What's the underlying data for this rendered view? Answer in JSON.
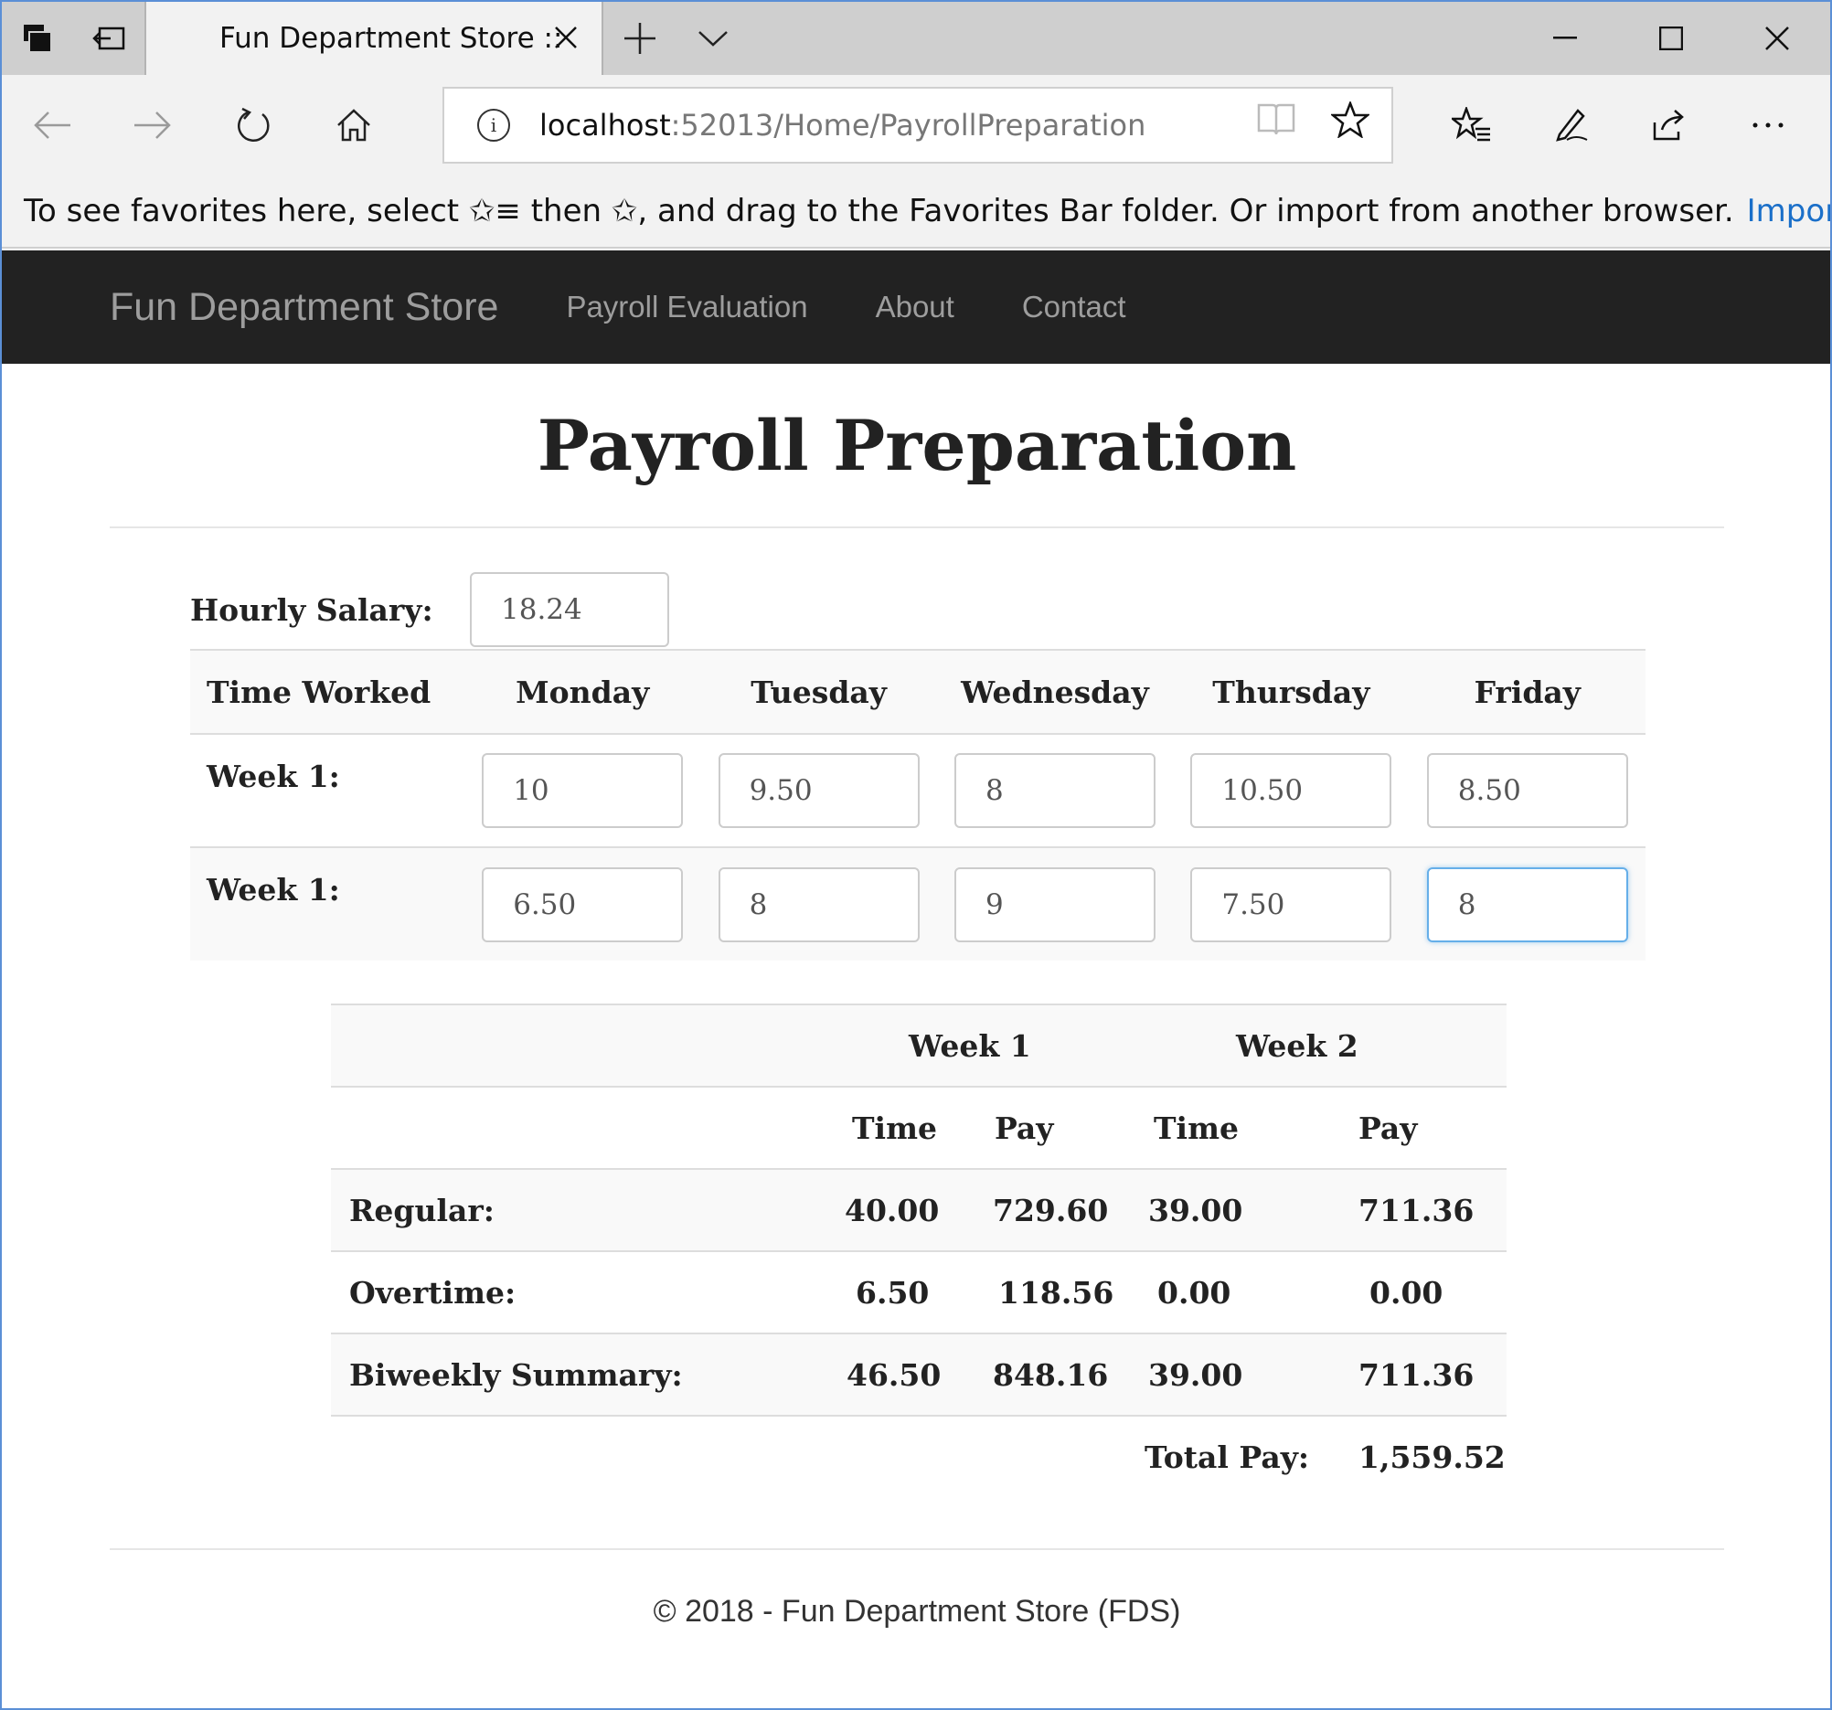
{
  "browser": {
    "tab_title": "Fun Department Store ::",
    "url_host": "localhost",
    "url_path": ":52013/Home/PayrollPreparation",
    "favorites_hint": "To see favorites here, select  ✩≡  then ✩, and drag to the Favorites Bar folder. Or import from another browser.",
    "import_link": "Import fav"
  },
  "site": {
    "brand": "Fun Department Store",
    "nav": [
      "Payroll Evaluation",
      "About",
      "Contact"
    ]
  },
  "page": {
    "title": "Payroll Preparation",
    "salary_label": "Hourly Salary:",
    "salary_value": "18.24"
  },
  "hours_table": {
    "headers": [
      "Time Worked",
      "Monday",
      "Tuesday",
      "Wednesday",
      "Thursday",
      "Friday"
    ],
    "rows": [
      {
        "label": "Week 1:",
        "values": [
          "10",
          "9.50",
          "8",
          "10.50",
          "8.50"
        ]
      },
      {
        "label": "Week 1:",
        "values": [
          "6.50",
          "8",
          "9",
          "7.50",
          "8"
        ]
      }
    ]
  },
  "summary": {
    "week_headers": [
      "Week 1",
      "Week 2"
    ],
    "sub_headers": [
      "Time",
      "Pay",
      "Time",
      "Pay"
    ],
    "rows": [
      {
        "label": "Regular:",
        "values": [
          "40.00",
          "729.60",
          "39.00",
          "711.36"
        ]
      },
      {
        "label": "Overtime:",
        "values": [
          "6.50",
          "118.56",
          "0.00",
          "0.00"
        ]
      },
      {
        "label": "Biweekly Summary:",
        "values": [
          "46.50",
          "848.16",
          "39.00",
          "711.36"
        ]
      }
    ],
    "total_label": "Total Pay:",
    "total_value": "1,559.52"
  },
  "footer": "© 2018 - Fun Department Store (FDS)"
}
